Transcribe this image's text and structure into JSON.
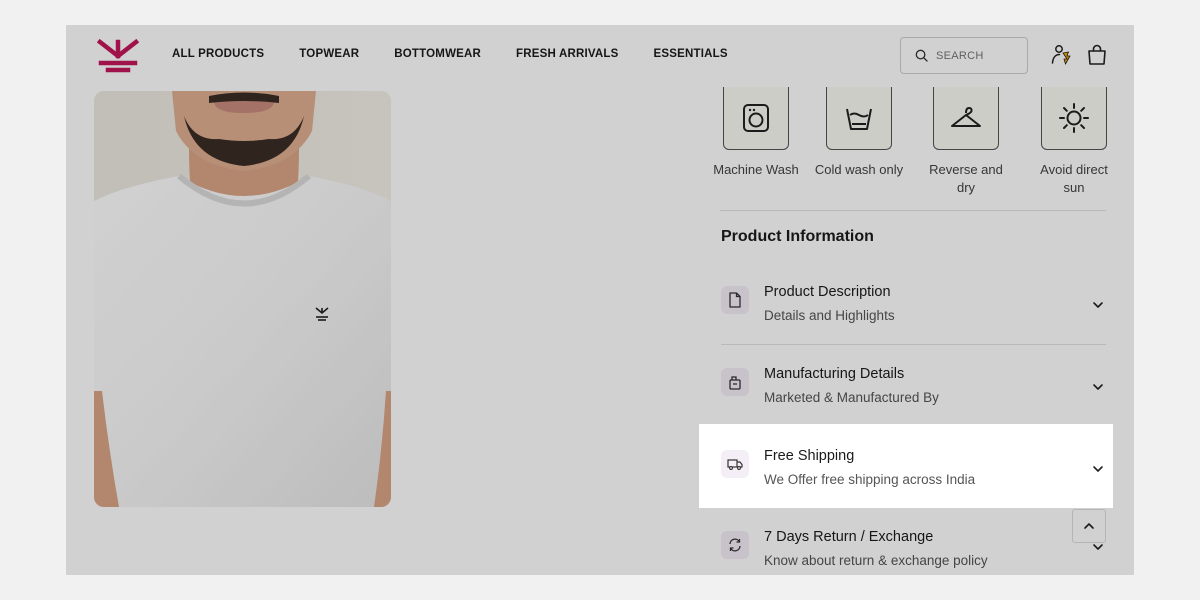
{
  "brand": {
    "accent": "#c2185b"
  },
  "nav": {
    "items": [
      {
        "label": "ALL PRODUCTS"
      },
      {
        "label": "TOPWEAR"
      },
      {
        "label": "BOTTOMWEAR"
      },
      {
        "label": "FRESH ARRIVALS"
      },
      {
        "label": "ESSENTIALS"
      }
    ]
  },
  "search": {
    "placeholder": "SEARCH"
  },
  "header_icons": [
    "account-icon",
    "shopping-bag-icon"
  ],
  "care": [
    {
      "icon": "washing-machine-icon",
      "label": "Machine Wash"
    },
    {
      "icon": "cold-wash-icon",
      "label": "Cold wash only"
    },
    {
      "icon": "hanger-icon",
      "label": "Reverse and dry"
    },
    {
      "icon": "sun-icon",
      "label": "Avoid direct sun"
    }
  ],
  "product_info": {
    "title": "Product Information",
    "items": [
      {
        "icon": "document-icon",
        "title": "Product Description",
        "subtitle": "Details and Highlights"
      },
      {
        "icon": "factory-icon",
        "title": "Manufacturing Details",
        "subtitle": "Marketed & Manufactured By"
      },
      {
        "icon": "truck-icon",
        "title": "Free Shipping",
        "subtitle": "We Offer free shipping across India"
      },
      {
        "icon": "return-icon",
        "title": "7 Days Return / Exchange",
        "subtitle": "Know about return & exchange policy"
      }
    ]
  }
}
